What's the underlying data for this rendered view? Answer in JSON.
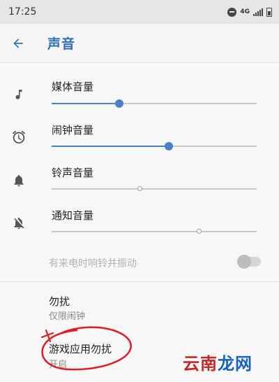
{
  "status_bar": {
    "time": "17:25",
    "network": "4G"
  },
  "toolbar": {
    "title": "声音",
    "back_icon": "arrow-left-icon",
    "accent": "#2f6fb7"
  },
  "volumes": [
    {
      "label": "媒体音量",
      "icon": "music-note-icon",
      "level": 0.33
    },
    {
      "label": "闹钟音量",
      "icon": "alarm-clock-icon",
      "level": 0.57
    },
    {
      "label": "铃声音量",
      "icon": "bell-icon",
      "level": 0.43
    },
    {
      "label": "通知音量",
      "icon": "bell-off-icon",
      "level": 0.72
    }
  ],
  "vibrate": {
    "label": "有来电时响铃并振动",
    "enabled": false
  },
  "dnd": {
    "title": "勿扰",
    "summary": "仅限闹钟"
  },
  "game_dnd": {
    "title": "游戏应用勿扰",
    "summary": "开启"
  },
  "watermark": {
    "part1": "云南",
    "part2": "龙网"
  },
  "colors": {
    "slider_active": "#4a80c4",
    "annotation": "#e01b24"
  }
}
